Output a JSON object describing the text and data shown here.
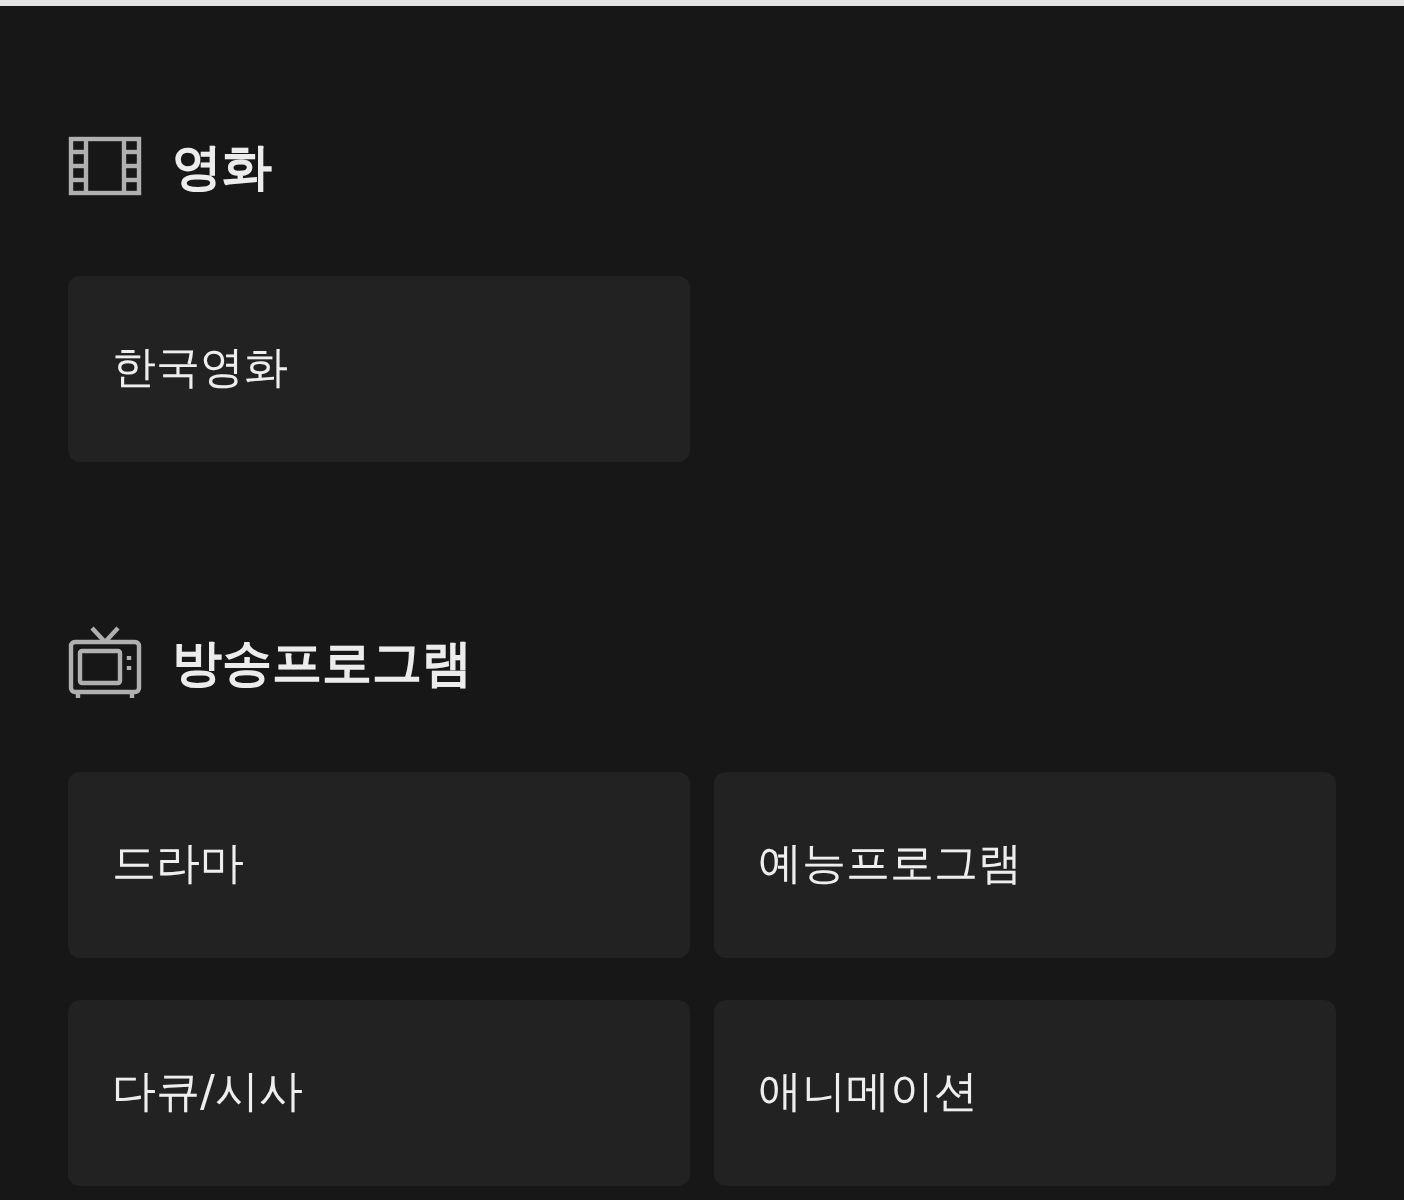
{
  "sections": [
    {
      "kind": "film",
      "title": "영화",
      "items": [
        "한국영화"
      ]
    },
    {
      "kind": "tv",
      "title": "방송프로그램",
      "items": [
        "드라마",
        "예능프로그램",
        "다큐/시사",
        "애니메이션"
      ]
    }
  ]
}
